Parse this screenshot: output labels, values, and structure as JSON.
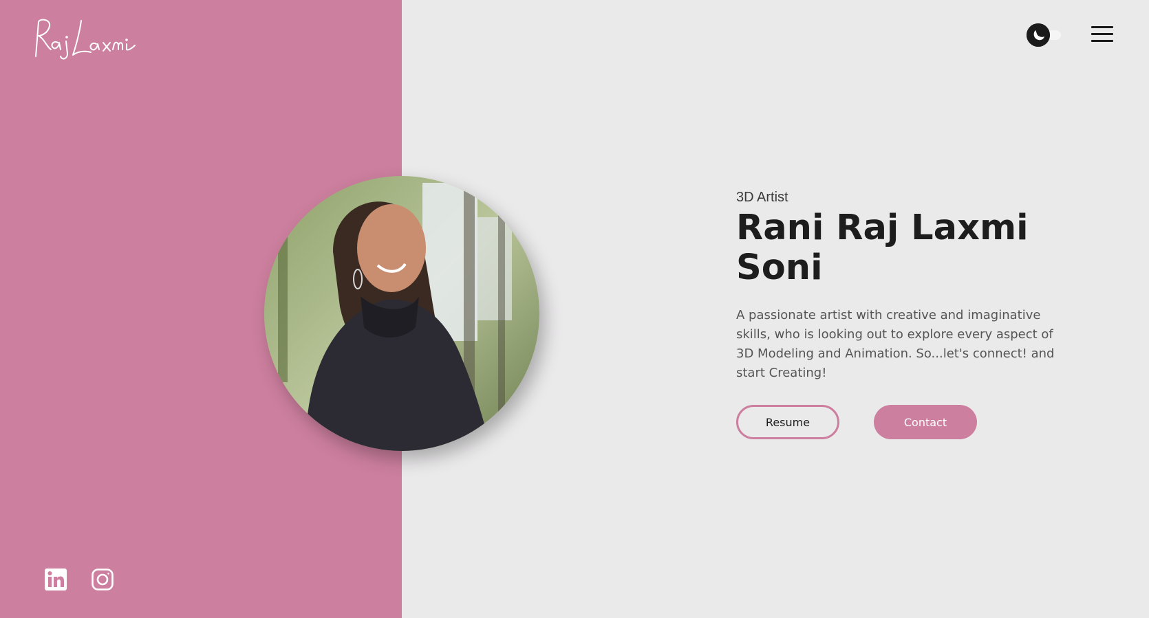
{
  "brand": {
    "logo_text": "Raj Laxmi",
    "accent_color": "#cc7f9e",
    "background_color": "#ebeaeb"
  },
  "header": {
    "theme_toggle_icon": "moon-icon",
    "menu_icon": "hamburger-menu-icon"
  },
  "hero": {
    "subtitle": "3D Artist",
    "name_line_1": "Rani Raj Laxmi",
    "name_line_2": "Soni",
    "description": "A passionate artist with creative and imaginative skills, who is looking out to explore every aspect of 3D Modeling and Animation. So...let's connect! and start Creating!",
    "buttons": {
      "resume": "Resume",
      "contact": "Contact"
    }
  },
  "socials": [
    {
      "icon": "linkedin-icon"
    },
    {
      "icon": "instagram-icon"
    }
  ]
}
